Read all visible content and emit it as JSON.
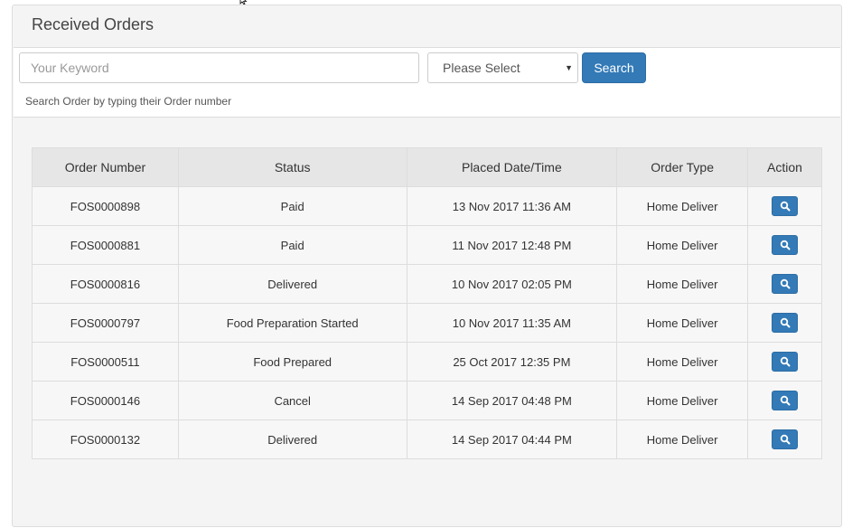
{
  "page": {
    "title": "Received Orders"
  },
  "search": {
    "keyword_placeholder": "Your Keyword",
    "keyword_value": "",
    "select_value": "Please Select",
    "button_label": "Search",
    "help_text": "Search Order by typing their Order number"
  },
  "table": {
    "headers": [
      "Order Number",
      "Status",
      "Placed Date/Time",
      "Order Type",
      "Action"
    ],
    "rows": [
      {
        "order_number": "FOS0000898",
        "status": "Paid",
        "placed": "13 Nov 2017 11:36 AM",
        "order_type": "Home Deliver"
      },
      {
        "order_number": "FOS0000881",
        "status": "Paid",
        "placed": "11 Nov 2017 12:48 PM",
        "order_type": "Home Deliver"
      },
      {
        "order_number": "FOS0000816",
        "status": "Delivered",
        "placed": "10 Nov 2017 02:05 PM",
        "order_type": "Home Deliver"
      },
      {
        "order_number": "FOS0000797",
        "status": "Food Preparation Started",
        "placed": "10 Nov 2017 11:35 AM",
        "order_type": "Home Deliver"
      },
      {
        "order_number": "FOS0000511",
        "status": "Food Prepared",
        "placed": "25 Oct 2017 12:35 PM",
        "order_type": "Home Deliver"
      },
      {
        "order_number": "FOS0000146",
        "status": "Cancel",
        "placed": "14 Sep 2017 04:48 PM",
        "order_type": "Home Deliver"
      },
      {
        "order_number": "FOS0000132",
        "status": "Delivered",
        "placed": "14 Sep 2017 04:44 PM",
        "order_type": "Home Deliver"
      }
    ],
    "action_icon": "search-icon"
  },
  "colors": {
    "primary": "#337ab7",
    "panel_bg": "#f4f4f4",
    "header_bg": "#e6e6e6",
    "row_bg": "#f7f7f7"
  }
}
